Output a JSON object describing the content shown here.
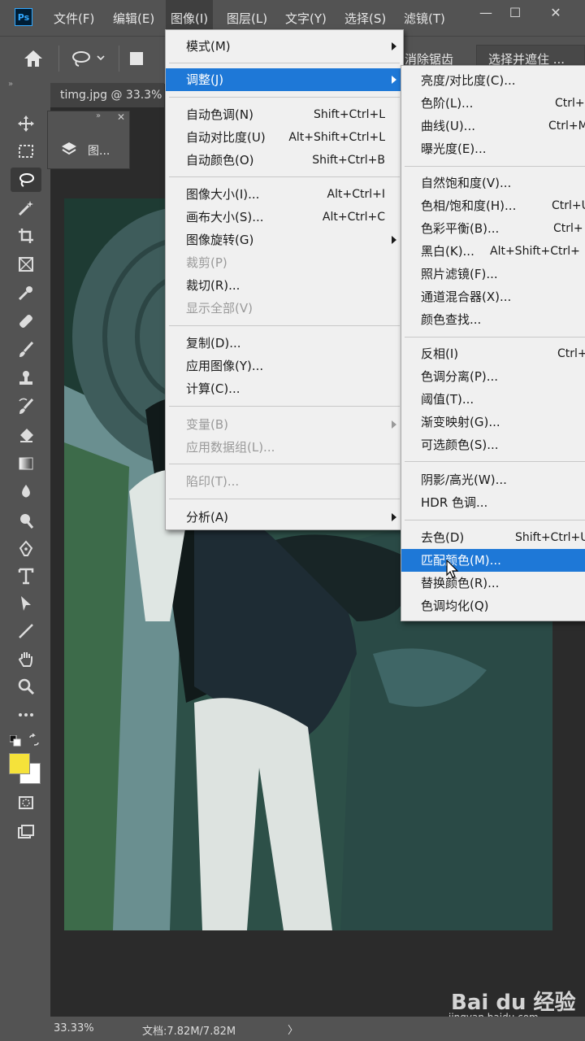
{
  "app": {
    "logo": "Ps"
  },
  "menubar": {
    "items": [
      "文件(F)",
      "编辑(E)",
      "图像(I)",
      "图层(L)",
      "文字(Y)",
      "选择(S)",
      "滤镜(T)"
    ],
    "active_index": 2
  },
  "window_controls": {
    "minimize": "—",
    "maximize": "☐",
    "close": "✕"
  },
  "options_bar": {
    "antialias_label": "消除锯齿",
    "select_mask_label": "选择并遮住 ..."
  },
  "document": {
    "tab_title": "timg.jpg @ 33.3%"
  },
  "panel": {
    "label": "图..."
  },
  "image_menu": {
    "items": [
      {
        "label": "模式(M)",
        "shortcut": "",
        "submenu": true,
        "disabled": false
      },
      {
        "label": "调整(J)",
        "shortcut": "",
        "submenu": true,
        "disabled": false,
        "highlighted": true
      },
      {
        "label": "自动色调(N)",
        "shortcut": "Shift+Ctrl+L",
        "submenu": false,
        "disabled": false
      },
      {
        "label": "自动对比度(U)",
        "shortcut": "Alt+Shift+Ctrl+L",
        "submenu": false,
        "disabled": false
      },
      {
        "label": "自动颜色(O)",
        "shortcut": "Shift+Ctrl+B",
        "submenu": false,
        "disabled": false
      },
      {
        "label": "图像大小(I)...",
        "shortcut": "Alt+Ctrl+I",
        "submenu": false,
        "disabled": false
      },
      {
        "label": "画布大小(S)...",
        "shortcut": "Alt+Ctrl+C",
        "submenu": false,
        "disabled": false
      },
      {
        "label": "图像旋转(G)",
        "shortcut": "",
        "submenu": true,
        "disabled": false
      },
      {
        "label": "裁剪(P)",
        "shortcut": "",
        "submenu": false,
        "disabled": true
      },
      {
        "label": "裁切(R)...",
        "shortcut": "",
        "submenu": false,
        "disabled": false
      },
      {
        "label": "显示全部(V)",
        "shortcut": "",
        "submenu": false,
        "disabled": true
      },
      {
        "label": "复制(D)...",
        "shortcut": "",
        "submenu": false,
        "disabled": false
      },
      {
        "label": "应用图像(Y)...",
        "shortcut": "",
        "submenu": false,
        "disabled": false
      },
      {
        "label": "计算(C)...",
        "shortcut": "",
        "submenu": false,
        "disabled": false
      },
      {
        "label": "变量(B)",
        "shortcut": "",
        "submenu": true,
        "disabled": true
      },
      {
        "label": "应用数据组(L)...",
        "shortcut": "",
        "submenu": false,
        "disabled": true
      },
      {
        "label": "陷印(T)...",
        "shortcut": "",
        "submenu": false,
        "disabled": true
      },
      {
        "label": "分析(A)",
        "shortcut": "",
        "submenu": true,
        "disabled": false
      }
    ]
  },
  "adjust_menu": {
    "items": [
      {
        "label": "亮度/对比度(C)...",
        "shortcut": ""
      },
      {
        "label": "色阶(L)...",
        "shortcut": "Ctrl+"
      },
      {
        "label": "曲线(U)...",
        "shortcut": "Ctrl+M"
      },
      {
        "label": "曝光度(E)...",
        "shortcut": ""
      },
      {
        "label": "自然饱和度(V)...",
        "shortcut": ""
      },
      {
        "label": "色相/饱和度(H)...",
        "shortcut": "Ctrl+U"
      },
      {
        "label": "色彩平衡(B)...",
        "shortcut": "Ctrl+"
      },
      {
        "label": "黑白(K)...",
        "shortcut": "Alt+Shift+Ctrl+"
      },
      {
        "label": "照片滤镜(F)...",
        "shortcut": ""
      },
      {
        "label": "通道混合器(X)...",
        "shortcut": ""
      },
      {
        "label": "颜色查找...",
        "shortcut": ""
      },
      {
        "label": "反相(I)",
        "shortcut": "Ctrl+"
      },
      {
        "label": "色调分离(P)...",
        "shortcut": ""
      },
      {
        "label": "阈值(T)...",
        "shortcut": ""
      },
      {
        "label": "渐变映射(G)...",
        "shortcut": ""
      },
      {
        "label": "可选颜色(S)...",
        "shortcut": ""
      },
      {
        "label": "阴影/高光(W)...",
        "shortcut": ""
      },
      {
        "label": "HDR 色调...",
        "shortcut": ""
      },
      {
        "label": "去色(D)",
        "shortcut": "Shift+Ctrl+U"
      },
      {
        "label": "匹配颜色(M)...",
        "shortcut": "",
        "highlighted": true
      },
      {
        "label": "替换颜色(R)...",
        "shortcut": ""
      },
      {
        "label": "色调均化(Q)",
        "shortcut": ""
      }
    ]
  },
  "colors": {
    "foreground": "#f5e23a",
    "background": "#ffffff",
    "highlight": "#1e78d7"
  },
  "status": {
    "zoom": "33.33%",
    "doc_info": "文档:7.82M/7.82M",
    "arrow": "〉"
  },
  "watermark": {
    "brand": "Bai du 经验",
    "url": "jingyan.baidu.com"
  }
}
